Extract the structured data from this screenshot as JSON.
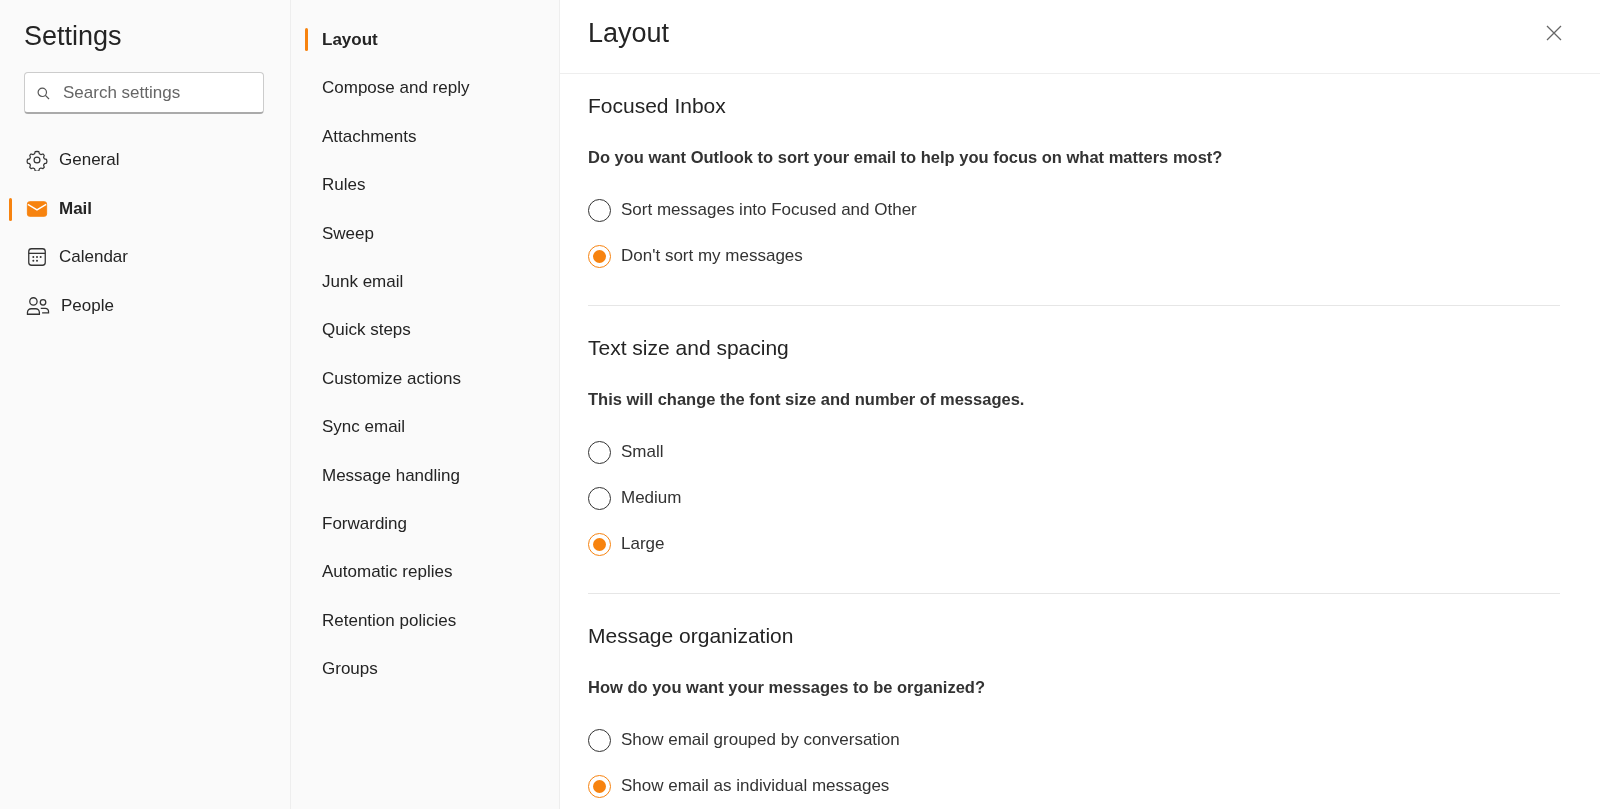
{
  "sidebar": {
    "title": "Settings",
    "search": {
      "placeholder": "Search settings"
    },
    "items": [
      {
        "label": "General",
        "selected": false
      },
      {
        "label": "Mail",
        "selected": true
      },
      {
        "label": "Calendar",
        "selected": false
      },
      {
        "label": "People",
        "selected": false
      }
    ]
  },
  "subnav": {
    "items": [
      {
        "label": "Layout",
        "selected": true
      },
      {
        "label": "Compose and reply",
        "selected": false
      },
      {
        "label": "Attachments",
        "selected": false
      },
      {
        "label": "Rules",
        "selected": false
      },
      {
        "label": "Sweep",
        "selected": false
      },
      {
        "label": "Junk email",
        "selected": false
      },
      {
        "label": "Quick steps",
        "selected": false
      },
      {
        "label": "Customize actions",
        "selected": false
      },
      {
        "label": "Sync email",
        "selected": false
      },
      {
        "label": "Message handling",
        "selected": false
      },
      {
        "label": "Forwarding",
        "selected": false
      },
      {
        "label": "Automatic replies",
        "selected": false
      },
      {
        "label": "Retention policies",
        "selected": false
      },
      {
        "label": "Groups",
        "selected": false
      }
    ]
  },
  "content": {
    "title": "Layout",
    "sections": [
      {
        "title": "Focused Inbox",
        "question": "Do you want Outlook to sort your email to help you focus on what matters most?",
        "options": [
          {
            "label": "Sort messages into Focused and Other",
            "selected": false
          },
          {
            "label": "Don't sort my messages",
            "selected": true
          }
        ]
      },
      {
        "title": "Text size and spacing",
        "question": "This will change the font size and number of messages.",
        "options": [
          {
            "label": "Small",
            "selected": false
          },
          {
            "label": "Medium",
            "selected": false
          },
          {
            "label": "Large",
            "selected": true
          }
        ]
      },
      {
        "title": "Message organization",
        "question": "How do you want your messages to be organized?",
        "options": [
          {
            "label": "Show email grouped by conversation",
            "selected": false
          },
          {
            "label": "Show email as individual messages",
            "selected": true
          }
        ]
      }
    ]
  }
}
